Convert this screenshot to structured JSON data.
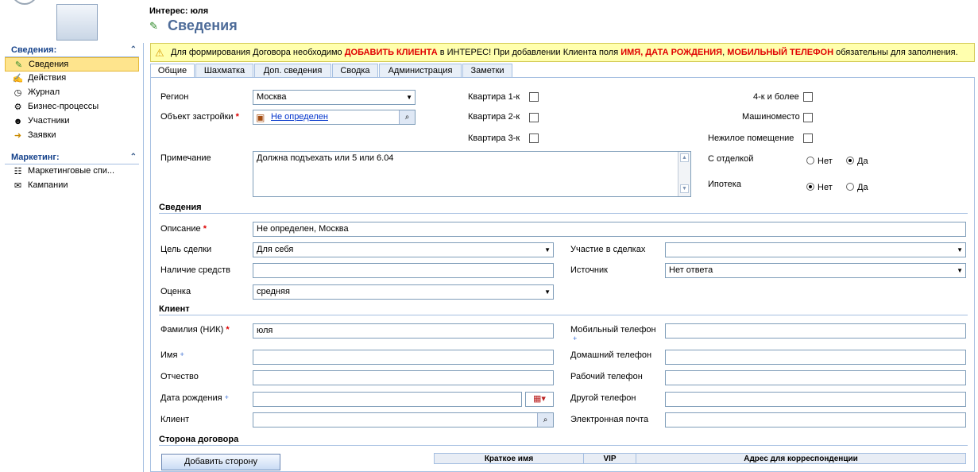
{
  "header": {
    "record_title": "Интерес: юля",
    "page_title": "Сведения"
  },
  "sidebar": {
    "groups": [
      {
        "title": "Сведения:",
        "items": [
          {
            "label": "Сведения",
            "icon": "info-icon",
            "selected": true
          },
          {
            "label": "Действия",
            "icon": "activities-icon"
          },
          {
            "label": "Журнал",
            "icon": "history-icon"
          },
          {
            "label": "Бизнес-процессы",
            "icon": "workflow-icon"
          },
          {
            "label": "Участники",
            "icon": "participants-icon"
          },
          {
            "label": "Заявки",
            "icon": "requests-icon"
          }
        ]
      },
      {
        "title": "Маркетинг:",
        "items": [
          {
            "label": "Маркетинговые спи...",
            "icon": "marketing-list-icon"
          },
          {
            "label": "Кампании",
            "icon": "campaign-icon"
          }
        ]
      }
    ]
  },
  "notice": {
    "part1": "Для формирования Договора необходимо ",
    "highlight1": "ДОБАВИТЬ КЛИЕНТА",
    "part2": " в ИНТЕРЕС! При добавлении Клиента поля ",
    "highlight2": "ИМЯ, ДАТА РОЖДЕНИЯ",
    "part3": ", ",
    "highlight3": "МОБИЛЬНЫЙ ТЕЛЕФОН",
    "part4": " обязательны для заполнения.",
    "highlight_color": "#e00000"
  },
  "tabs": [
    "Общие",
    "Шахматка",
    "Доп. сведения",
    "Сводка",
    "Администрация",
    "Заметки"
  ],
  "general": {
    "region_label": "Регион",
    "region_value": "Москва",
    "object_label": "Объект застройки",
    "object_value": "Не определен",
    "note_label": "Примечание",
    "note_value": "Должна подъехать или 5 или 6.04",
    "flat1_label": "Квартира 1-к",
    "flat2_label": "Квартира 2-к",
    "flat3_label": "Квартира 3-к",
    "flat4_label": "4-к и более",
    "parking_label": "Машиноместо",
    "nonres_label": "Нежилое помещение",
    "finish_label": "С отделкой",
    "mortgage_label": "Ипотека",
    "no_label": "Нет",
    "yes_label": "Да",
    "finish_value": "Да",
    "mortgage_value": "Нет"
  },
  "details": {
    "section_title": "Сведения",
    "description_label": "Описание",
    "description_value": "Не определен, Москва",
    "purpose_label": "Цель сделки",
    "purpose_value": "Для себя",
    "funds_label": "Наличие средств",
    "funds_value": "",
    "rating_label": "Оценка",
    "rating_value": "средняя",
    "participation_label": "Участие в сделках",
    "participation_value": "",
    "source_label": "Источник",
    "source_value": "Нет ответа"
  },
  "client": {
    "section_title": "Клиент",
    "lastname_label": "Фамилия (НИК)",
    "lastname_value": "юля",
    "firstname_label": "Имя",
    "middlename_label": "Отчество",
    "birthdate_label": "Дата рождения",
    "client_label": "Клиент",
    "mobile_label": "Мобильный телефон",
    "home_label": "Домашний телефон",
    "work_label": "Рабочий телефон",
    "other_label": "Другой телефон",
    "email_label": "Электронная почта"
  },
  "party": {
    "section_title": "Сторона договора",
    "add_button": "Добавить сторону",
    "columns": [
      "Краткое имя",
      "VIP",
      "Адрес для корреспонденции"
    ]
  }
}
